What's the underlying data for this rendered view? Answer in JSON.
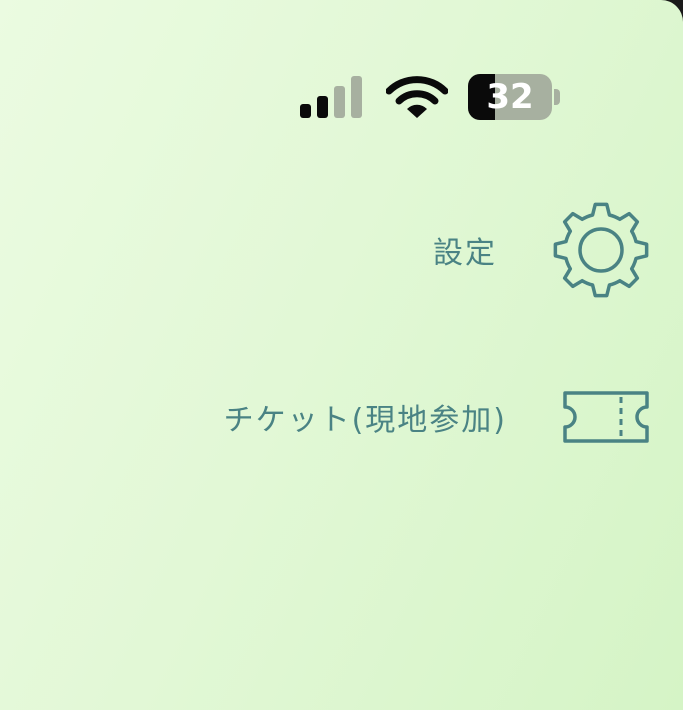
{
  "status_bar": {
    "battery_level": "32",
    "battery_fraction": 0.32,
    "signal_bars_active": 2,
    "signal_bars_total": 4,
    "wifi_icon": "wifi-icon",
    "signal_icon": "cellular-signal-icon",
    "battery_icon": "battery-icon"
  },
  "menu": {
    "items": [
      {
        "label": "設定",
        "icon": "gear-icon"
      },
      {
        "label": "チケット(現地参加)",
        "icon": "ticket-icon"
      }
    ]
  },
  "colors": {
    "accent": "#4a8384",
    "background_start": "#ebfbe1",
    "background_end": "#d5f4c6",
    "status_active": "#0a0a0a",
    "status_inactive": "#a7b0a0"
  }
}
